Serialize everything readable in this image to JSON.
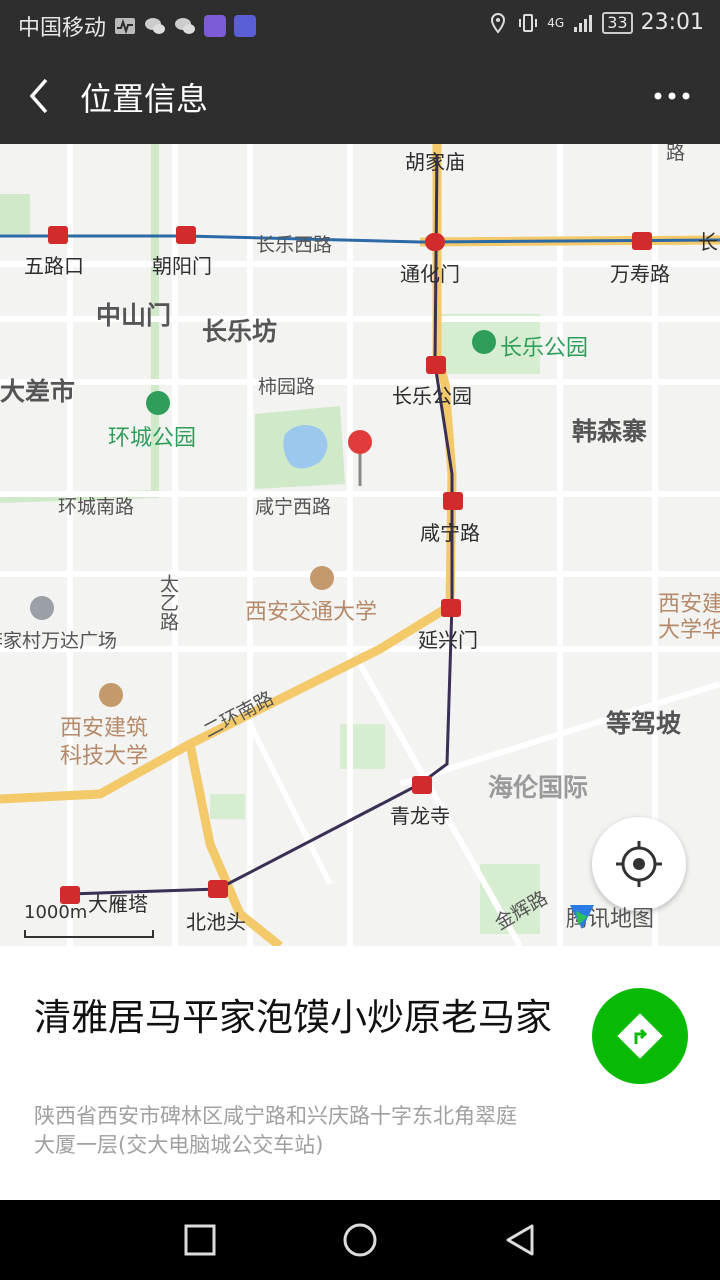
{
  "status_bar": {
    "carrier": "中国移动",
    "battery": "33",
    "network": "4G",
    "time": "23:01"
  },
  "header": {
    "title": "位置信息",
    "back_icon": "chevron-left-icon",
    "more_icon": "more-dots-icon"
  },
  "map": {
    "labels": {
      "hujiamiao": "胡家庙",
      "wuluko": "五路口",
      "chaoyangmen": "朝阳门",
      "changle_xilu": "长乐西路",
      "tonghuamen": "通化门",
      "wanshoulu": "万寿路",
      "zhongshanmen": "中山门",
      "changlefang": "长乐坊",
      "changle_park": "长乐公园",
      "dachashi": "大差市",
      "shiyuanlu": "柿园路",
      "changle_park_station": "长乐公园",
      "huancheng_park": "环城公园",
      "hansenzhai": "韩森寨",
      "huancheng_nanlu": "环城南路",
      "xianning_xilu": "咸宁西路",
      "xianninglu": "咸宁路",
      "taiyilu": "太乙路",
      "xjtu": "西安交通大学",
      "xian_right": "西安建",
      "daxue_right": "大学华",
      "wanda": "李家村万达广场",
      "yanxingmen": "延兴门",
      "erhuan_nanlu": "二环南路",
      "dengjiapo": "等驾坡",
      "xauat_1": "西安建筑",
      "xauat_2": "科技大学",
      "hailun": "海伦国际",
      "qinglongsi": "青龙寺",
      "jinjilu": "金辉路",
      "dayanta": "大雁塔",
      "beichitou": "北池头",
      "lu_corner": "路",
      "chang_right": "长"
    },
    "scale_text": "1000m",
    "brand": "腾讯地图",
    "colors": {
      "metro_red": "#d12b2b",
      "main_road": "#f3c96a",
      "park_green": "#cfe9c9",
      "water_blue": "#9cc8ee"
    }
  },
  "place": {
    "name": "清雅居马平家泡馍小炒原老马家",
    "address": "陕西省西安市碑林区咸宁路和兴庆路十字东北角翠庭大厦一层(交大电脑城公交车站)"
  },
  "navigation_bar": {
    "recent_icon": "square-icon",
    "home_icon": "circle-icon",
    "back_icon": "triangle-back-icon"
  }
}
